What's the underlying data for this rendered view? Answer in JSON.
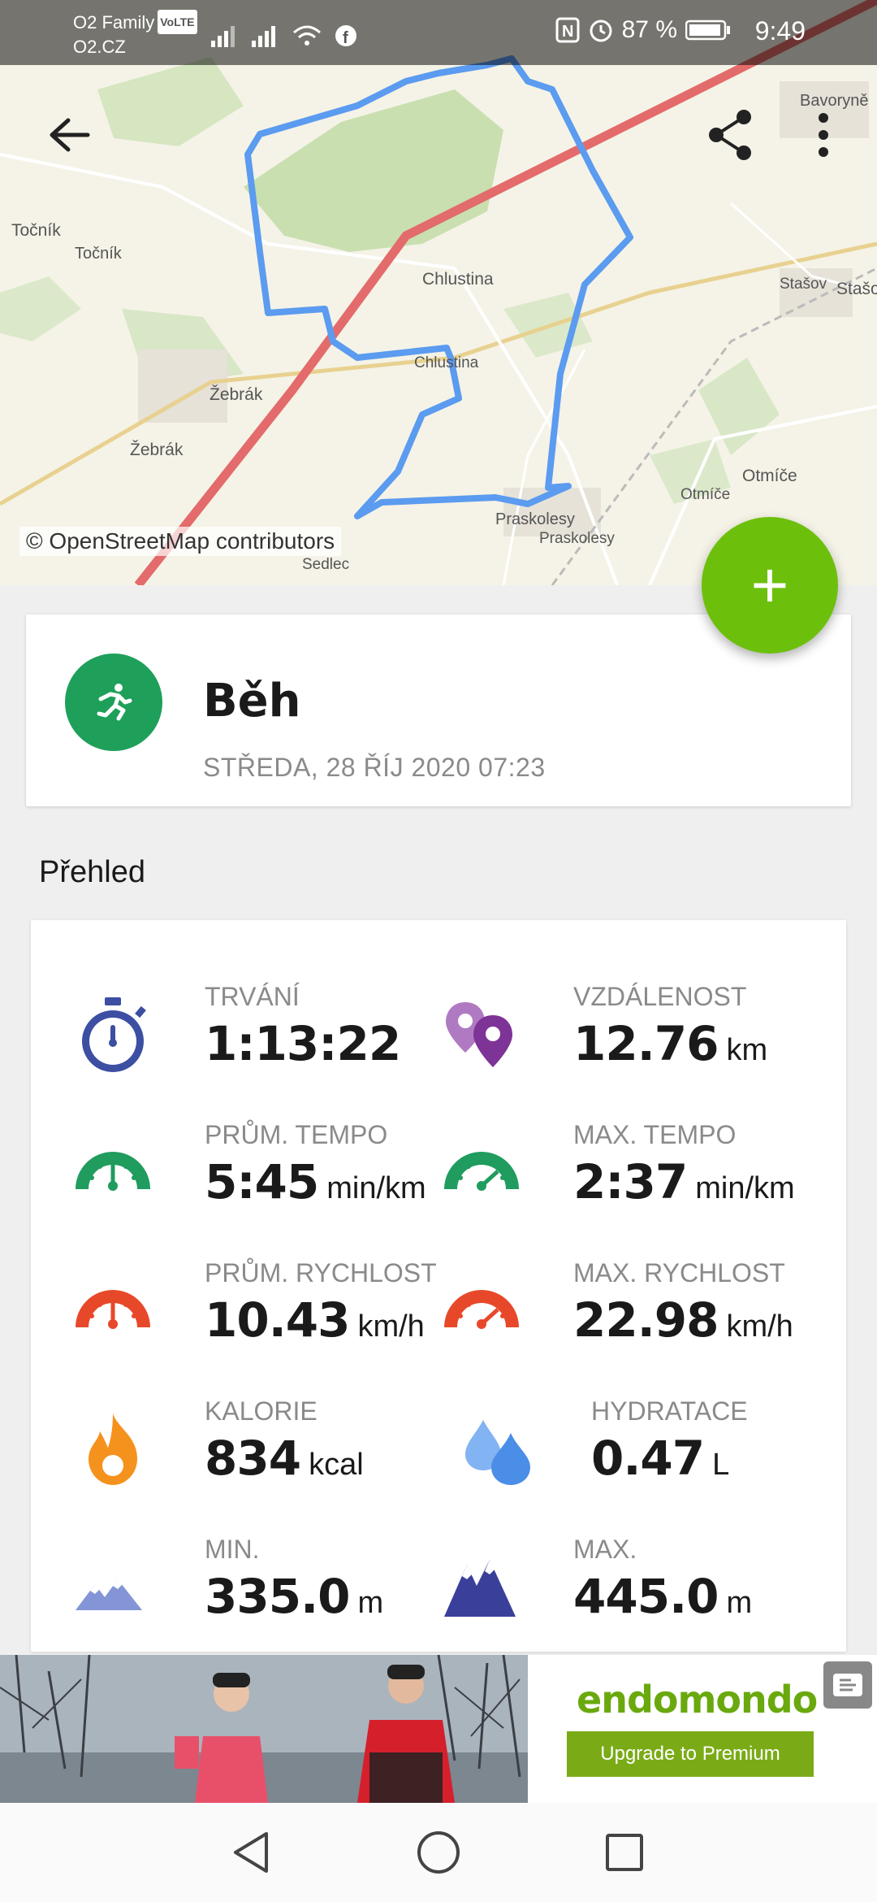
{
  "status_bar": {
    "carrier_line1": "O2 Family",
    "volte": "VoLTE",
    "carrier_line2": "O2.CZ",
    "battery_percent": "87 %",
    "time": "9:49"
  },
  "map": {
    "attribution": "© OpenStreetMap contributors",
    "place_labels": [
      "Bavoryně",
      "Točník",
      "Točník",
      "Chlustina",
      "Chlustina",
      "Stašov",
      "Stašo",
      "Žebrák",
      "Žebrák",
      "Otmíče",
      "Otmíče",
      "Praskolesy",
      "Praskolesy",
      "Sedlec"
    ],
    "route_color": "#5b9bf0"
  },
  "toolbar": {
    "back_icon": "arrow-left-icon",
    "share_icon": "share-icon",
    "more_icon": "more-vert-icon"
  },
  "fab": {
    "label": "+"
  },
  "workout": {
    "sport": "Běh",
    "date": "STŘEDA, 28 ŘÍJ 2020 07:23",
    "icon_color": "#1fa05a"
  },
  "overview": {
    "title": "Přehled",
    "stats": [
      {
        "label": "TRVÁNÍ",
        "value": "1:13:22",
        "unit": "",
        "icon": "stopwatch-icon"
      },
      {
        "label": "VZDÁLENOST",
        "value": "12.76",
        "unit": "km",
        "icon": "location-pins-icon"
      },
      {
        "label": "PRŮM. TEMPO",
        "value": "5:45",
        "unit": "min/km",
        "icon": "gauge-green-icon"
      },
      {
        "label": "MAX. TEMPO",
        "value": "2:37",
        "unit": "min/km",
        "icon": "gauge-green-max-icon"
      },
      {
        "label": "PRŮM. RYCHLOST",
        "value": "10.43",
        "unit": "km/h",
        "icon": "gauge-red-icon"
      },
      {
        "label": "MAX. RYCHLOST",
        "value": "22.98",
        "unit": "km/h",
        "icon": "gauge-red-max-icon"
      },
      {
        "label": "KALORIE",
        "value": "834",
        "unit": "kcal",
        "icon": "flame-icon"
      },
      {
        "label": "HYDRATACE",
        "value": "0.47",
        "unit": "L",
        "icon": "water-drops-icon"
      },
      {
        "label": "MIN.",
        "value": "335.0",
        "unit": "m",
        "icon": "mountain-min-icon"
      },
      {
        "label": "MAX.",
        "value": "445.0",
        "unit": "m",
        "icon": "mountain-max-icon"
      }
    ]
  },
  "ad": {
    "brand": "endomondo",
    "cta": "Upgrade to Premium"
  },
  "navbar": {
    "back_icon": "nav-back-icon",
    "home_icon": "nav-home-icon",
    "recents_icon": "nav-recents-icon"
  }
}
